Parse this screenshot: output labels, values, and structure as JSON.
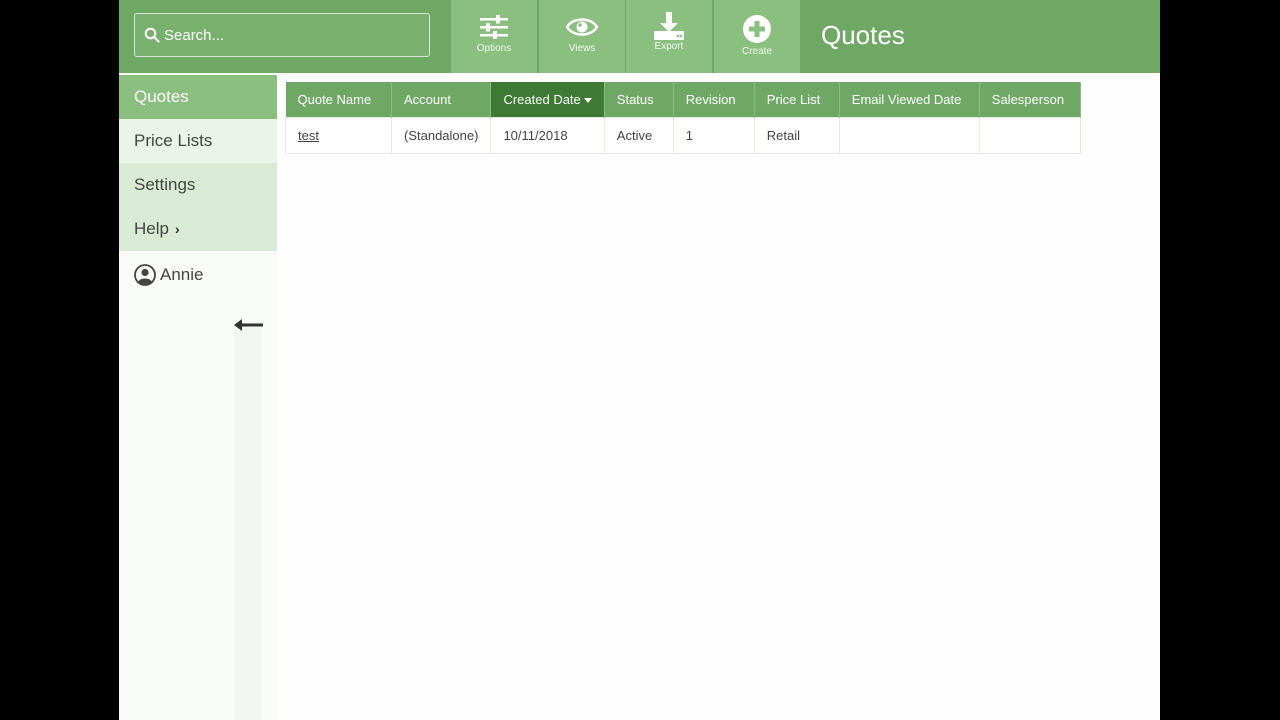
{
  "search": {
    "placeholder": "Search..."
  },
  "toolbar": {
    "options_label": "Options",
    "views_label": "Views",
    "export_label": "Export",
    "create_label": "Create"
  },
  "page": {
    "title": "Quotes"
  },
  "sidebar": {
    "items": [
      {
        "label": "Quotes",
        "active": true
      },
      {
        "label": "Price Lists"
      },
      {
        "label": "Settings"
      },
      {
        "label": "Help"
      }
    ],
    "user": {
      "name": "Annie"
    }
  },
  "table": {
    "columns": [
      "Quote Name",
      "Account",
      "Created Date",
      "Status",
      "Revision",
      "Price List",
      "Email Viewed Date",
      "Salesperson"
    ],
    "sorted_column": "Created Date",
    "sort_direction": "descending",
    "rows": [
      {
        "quote_name": "test",
        "account": "(Standalone)",
        "created_date": "10/11/2018",
        "status": "Active",
        "revision": "1",
        "price_list": "Retail",
        "email_viewed_date": "",
        "salesperson": ""
      }
    ]
  },
  "colors": {
    "header_green": "#6fa864",
    "button_green": "#8bbf80",
    "sorted_header": "#3d7a34",
    "sidebar_light": "#d9ebd5"
  }
}
